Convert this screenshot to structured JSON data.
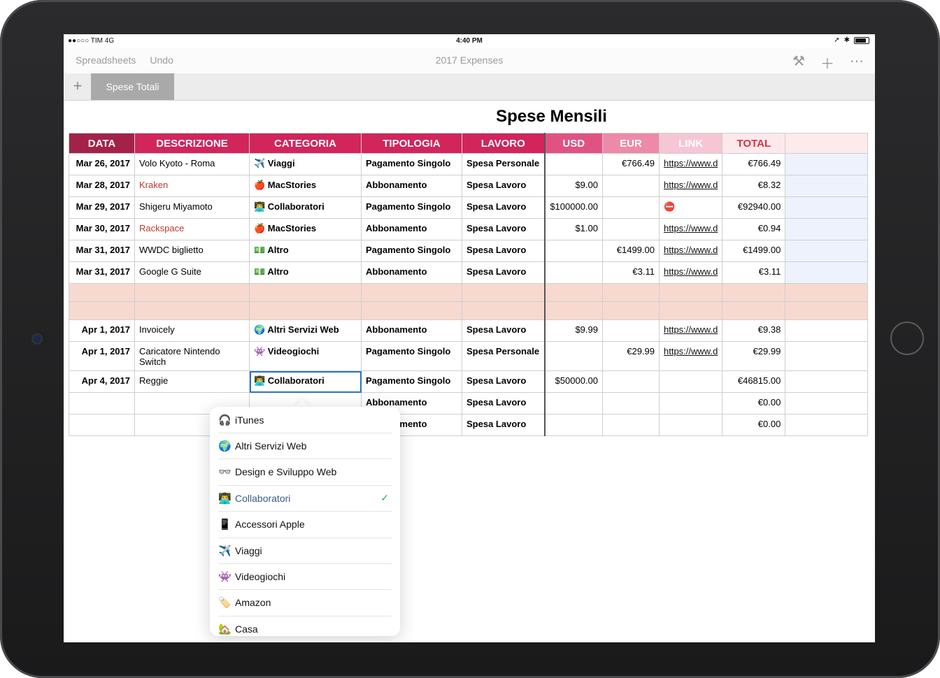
{
  "status": {
    "carrier": "●●○○○ TIM  4G",
    "time": "4:40 PM"
  },
  "toolbar": {
    "spreadsheets": "Spreadsheets",
    "undo": "Undo",
    "title": "2017 Expenses",
    "brush_icon": "paintbrush-icon",
    "add_icon": "plus-icon",
    "more_icon": "more-icon"
  },
  "tabs": {
    "add": "+",
    "active": "Spese Totali"
  },
  "sheet": {
    "title": "Spese Mensili"
  },
  "headers": [
    {
      "label": "DATA",
      "bg": "#a3224a"
    },
    {
      "label": "DESCRIZIONE",
      "bg": "#d1255c"
    },
    {
      "label": "CATEGORIA",
      "bg": "#d1255c"
    },
    {
      "label": "TIPOLOGIA",
      "bg": "#d1255c"
    },
    {
      "label": "LAVORO",
      "bg": "#d1255c"
    },
    {
      "label": "USD",
      "bg": "#e05282"
    },
    {
      "label": "EUR",
      "bg": "#ed8aa9"
    },
    {
      "label": "LINK",
      "bg": "#f6c6d5"
    },
    {
      "label": "TOTAL",
      "bg": "#fde9ec"
    },
    {
      "label": "",
      "bg": "#fdeaea"
    }
  ],
  "rows": [
    {
      "date": "Mar 26, 2017",
      "desc": "Volo Kyoto - Roma",
      "desc_red": false,
      "cat": "✈️ Viaggi",
      "type": "Pagamento Singolo",
      "work": "Spesa Personale",
      "usd": "",
      "eur": "€766.49",
      "link": "https://www.d",
      "total": "€766.49"
    },
    {
      "date": "Mar 28, 2017",
      "desc": "Kraken",
      "desc_red": true,
      "cat": "🍎 MacStories",
      "type": "Abbonamento",
      "work": "Spesa Lavoro",
      "usd": "$9.00",
      "eur": "",
      "link": "https://www.d",
      "total": "€8.32"
    },
    {
      "date": "Mar 29, 2017",
      "desc": "Shigeru Miyamoto",
      "desc_red": false,
      "cat": "👨‍💻 Collaboratori",
      "type": "Pagamento Singolo",
      "work": "Spesa Lavoro",
      "usd": "$100000.00",
      "eur": "",
      "link": "⛔",
      "total": "€92940.00"
    },
    {
      "date": "Mar 30, 2017",
      "desc": "Rackspace",
      "desc_red": true,
      "cat": "🍎 MacStories",
      "type": "Abbonamento",
      "work": "Spesa Lavoro",
      "usd": "$1.00",
      "eur": "",
      "link": "https://www.d",
      "total": "€0.94"
    },
    {
      "date": "Mar 31, 2017",
      "desc": "WWDC biglietto",
      "desc_red": false,
      "cat": "💵 Altro",
      "type": "Pagamento Singolo",
      "work": "Spesa Lavoro",
      "usd": "",
      "eur": "€1499.00",
      "link": "https://www.d",
      "total": "€1499.00"
    },
    {
      "date": "Mar 31, 2017",
      "desc": "Google G Suite",
      "desc_red": false,
      "cat": "💵 Altro",
      "type": "Abbonamento",
      "work": "Spesa Lavoro",
      "usd": "",
      "eur": "€3.11",
      "link": "https://www.d",
      "total": "€3.11"
    },
    {
      "spacer": true
    },
    {
      "spacer": true
    },
    {
      "date": "Apr 1, 2017",
      "desc": "Invoicely",
      "desc_red": false,
      "cat": "🌍 Altri Servizi Web",
      "type": "Abbonamento",
      "work": "Spesa Lavoro",
      "usd": "$9.99",
      "eur": "",
      "link": "https://www.d",
      "total": "€9.38"
    },
    {
      "date": "Apr 1, 2017",
      "desc": "Caricatore Nintendo Switch",
      "desc_red": false,
      "cat": "👾 Videogiochi",
      "type": "Pagamento Singolo",
      "work": "Spesa Personale",
      "usd": "",
      "eur": "€29.99",
      "link": "https://www.d",
      "total": "€29.99"
    },
    {
      "date": "Apr 4, 2017",
      "desc": "Reggie",
      "desc_red": false,
      "cat": "👨‍💻 Collaboratori",
      "type": "Pagamento Singolo",
      "work": "Spesa Lavoro",
      "usd": "$50000.00",
      "eur": "",
      "link": "",
      "total": "€46815.00",
      "selected": true
    },
    {
      "date": "",
      "desc": "",
      "desc_red": false,
      "cat": "",
      "type": "Abbonamento",
      "work": "Spesa Lavoro",
      "usd": "",
      "eur": "",
      "link": "",
      "total": "€0.00"
    },
    {
      "date": "",
      "desc": "",
      "desc_red": false,
      "cat": "",
      "type": "Abbonamento",
      "work": "Spesa Lavoro",
      "usd": "",
      "eur": "",
      "link": "",
      "total": "€0.00"
    }
  ],
  "popover": {
    "items": [
      {
        "emoji": "🎧",
        "label": "iTunes"
      },
      {
        "emoji": "🌍",
        "label": "Altri Servizi Web"
      },
      {
        "emoji": "👓",
        "label": "Design e Sviluppo Web"
      },
      {
        "emoji": "👨‍💻",
        "label": "Collaboratori",
        "selected": true
      },
      {
        "emoji": "📱",
        "label": "Accessori Apple"
      },
      {
        "emoji": "✈️",
        "label": "Viaggi"
      },
      {
        "emoji": "👾",
        "label": "Videogiochi"
      },
      {
        "emoji": "🏷️",
        "label": "Amazon"
      },
      {
        "emoji": "🏡",
        "label": "Casa"
      }
    ],
    "check": "✓"
  }
}
